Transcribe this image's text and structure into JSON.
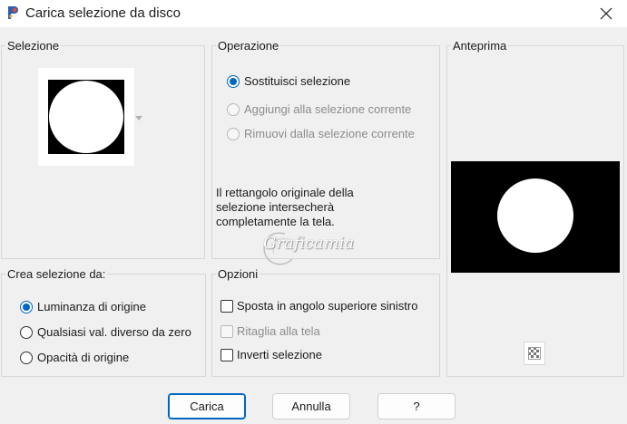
{
  "window": {
    "title": "Carica selezione da disco",
    "app_icon": "paintshop-pro-icon",
    "close_icon": "close-icon"
  },
  "selezione": {
    "label": "Selezione"
  },
  "operazione": {
    "label": "Operazione",
    "options": [
      {
        "label": "Sostituisci selezione",
        "checked": true,
        "enabled": true
      },
      {
        "label": "Aggiungi alla selezione corrente",
        "checked": false,
        "enabled": false
      },
      {
        "label": "Rimuovi dalla selezione corrente",
        "checked": false,
        "enabled": false
      }
    ],
    "note": [
      "Il rettangolo originale della",
      "selezione intersecherà",
      "completamente la tela."
    ]
  },
  "anteprima": {
    "label": "Anteprima",
    "zoom_icon": "checker-preview-icon"
  },
  "crea": {
    "label": "Crea selezione da:",
    "options": [
      {
        "label": "Luminanza di origine",
        "checked": true
      },
      {
        "label": "Qualsiasi val. diverso da zero",
        "checked": false
      },
      {
        "label": "Opacità di origine",
        "checked": false
      }
    ]
  },
  "opzioni": {
    "label": "Opzioni",
    "options": [
      {
        "label": "Sposta in angolo superiore sinistro",
        "checked": false,
        "enabled": true
      },
      {
        "label": "Ritaglia alla tela",
        "checked": false,
        "enabled": false
      },
      {
        "label": "Inverti selezione",
        "checked": false,
        "enabled": true
      }
    ]
  },
  "watermark": "Graficamia",
  "buttons": {
    "load": "Carica",
    "cancel": "Annulla",
    "help": "?"
  },
  "colors": {
    "accent": "#0067c0",
    "preview_bg": "#000000",
    "preview_fg": "#ffffff"
  }
}
